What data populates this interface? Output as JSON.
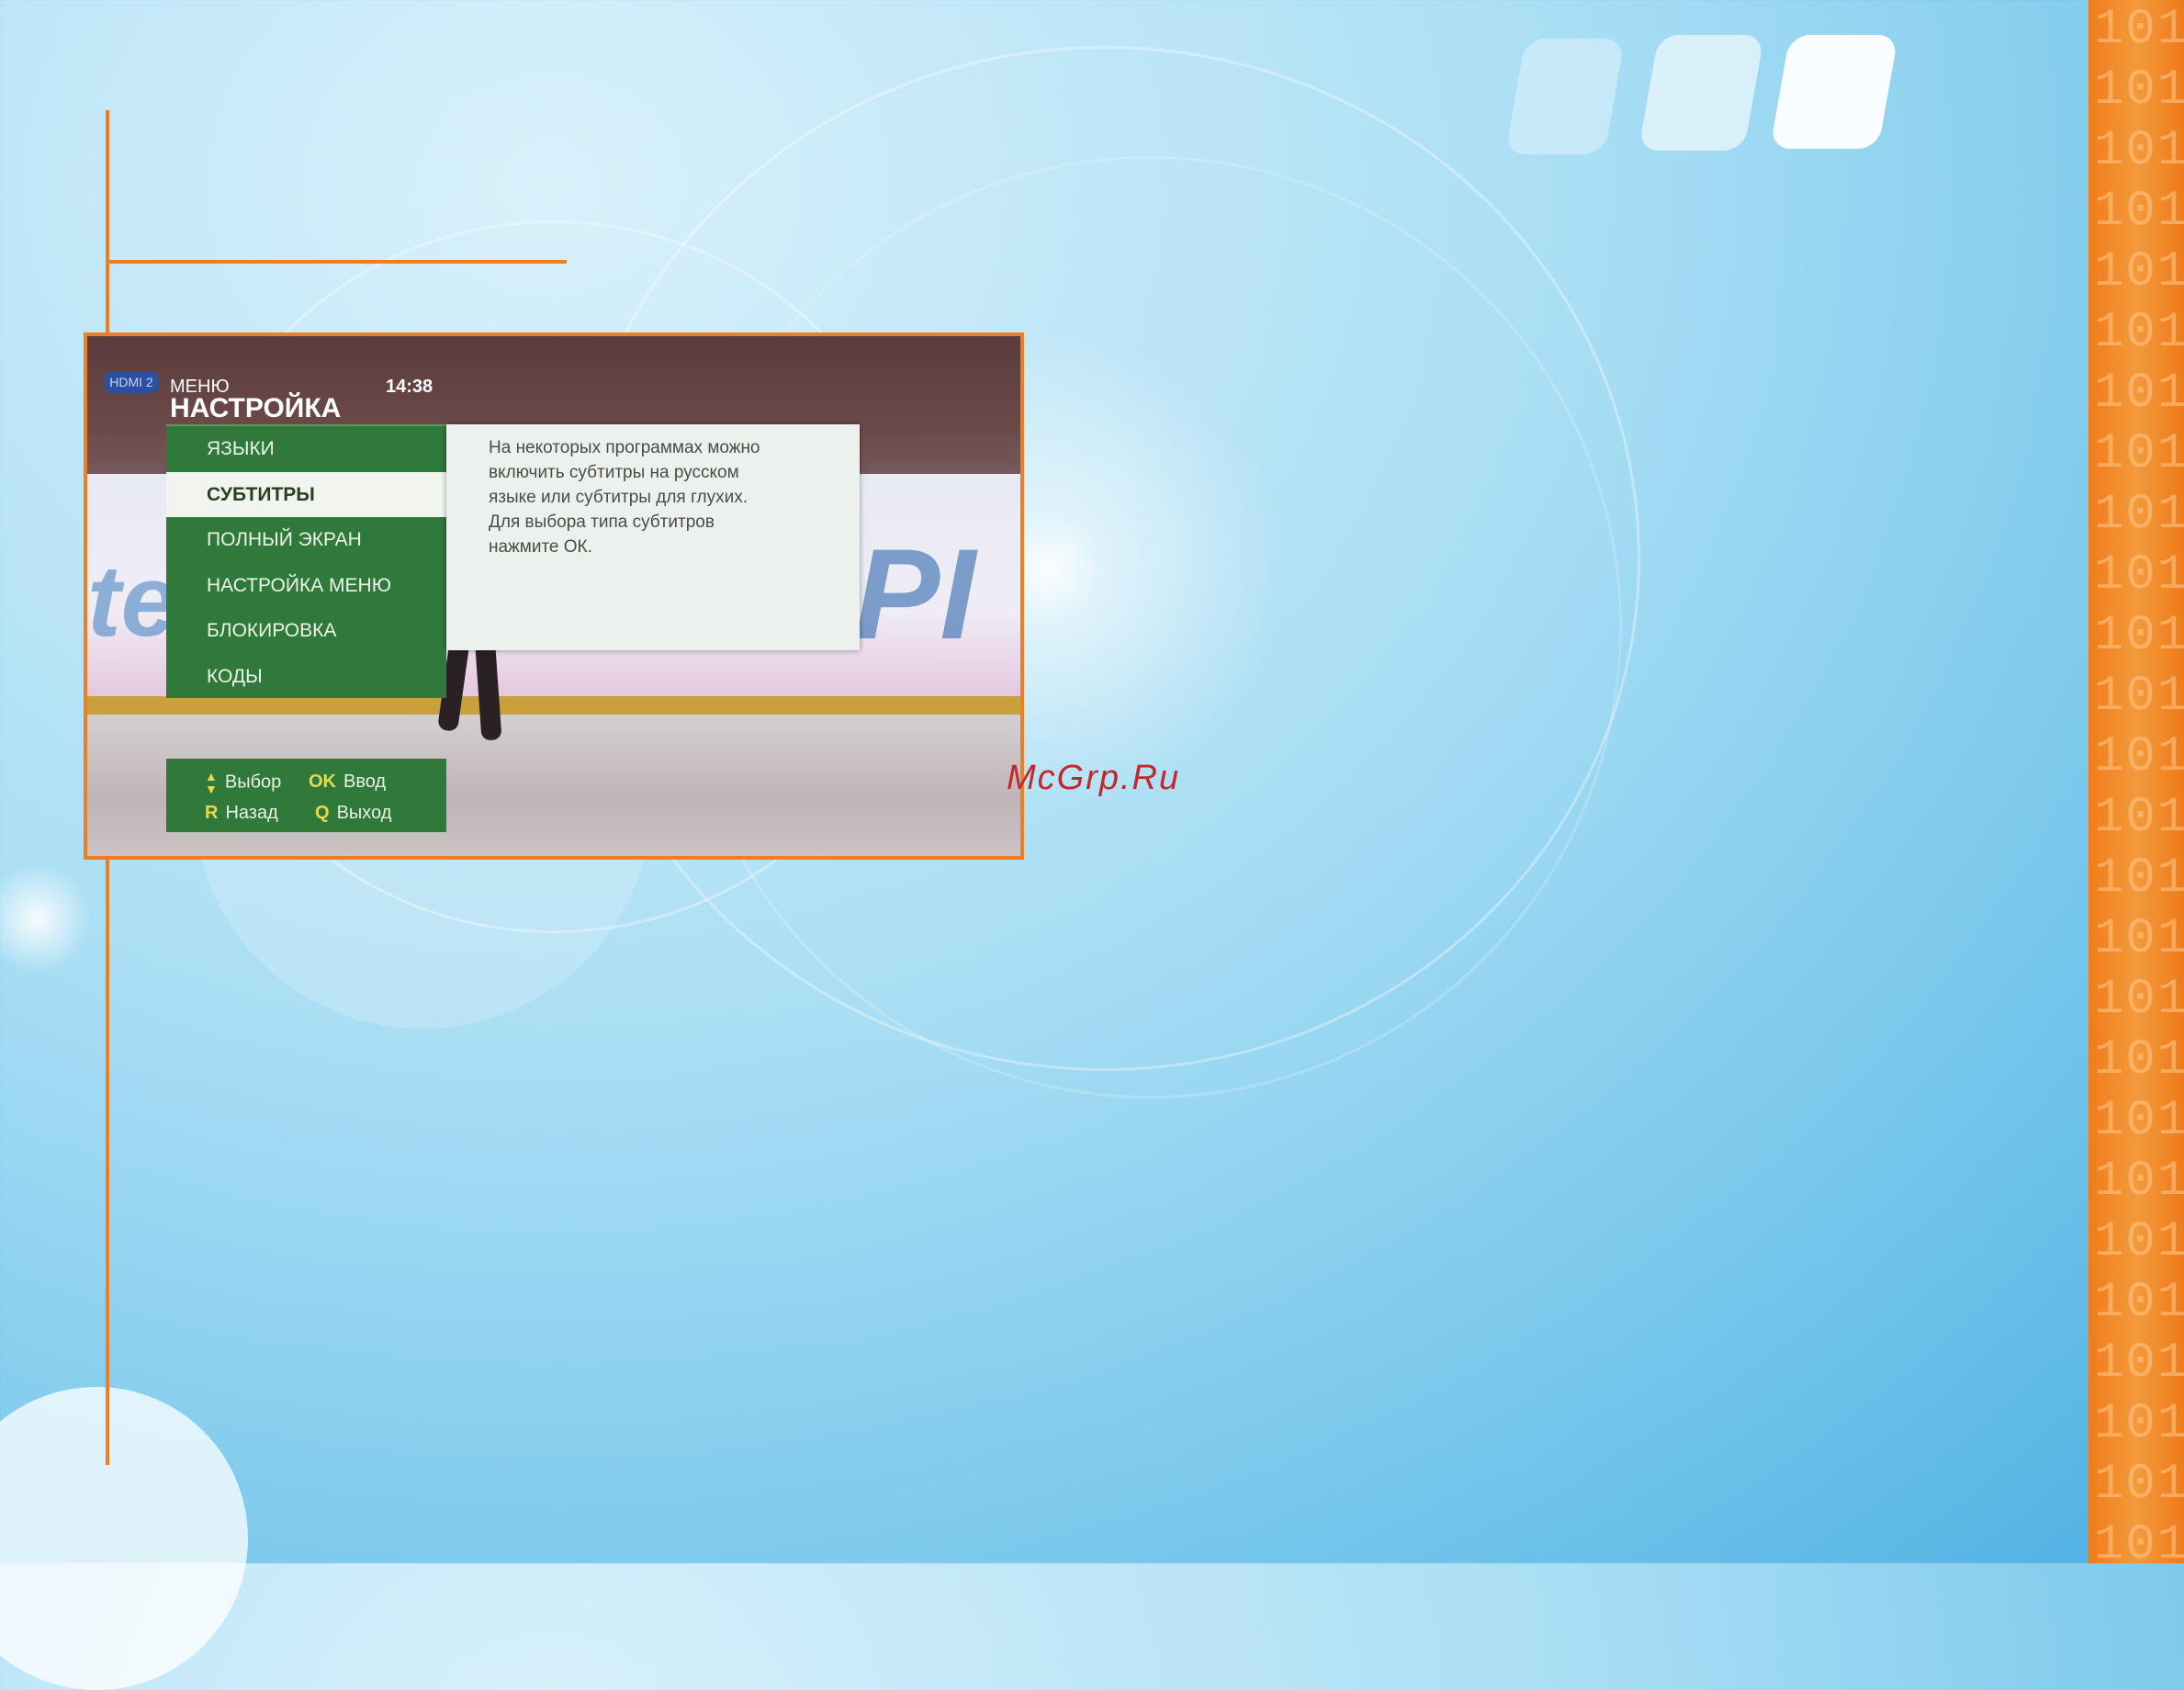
{
  "page": {
    "watermark": "McGrp.Ru",
    "strip_digits": [
      "101",
      "101",
      "101",
      "101",
      "101",
      "101",
      "101",
      "101",
      "101",
      "101",
      "101",
      "101",
      "101",
      "101",
      "101",
      "101",
      "101",
      "101",
      "101",
      "101",
      "101",
      "101",
      "101",
      "101",
      "101",
      "101"
    ],
    "colors": {
      "accent_orange": "#ef7d22",
      "menu_green": "#2f7a3a",
      "selected_bg": "#f2f5ef",
      "watermark_red": "#c2282d"
    }
  },
  "tv": {
    "input_badge": "HDMI 2",
    "menu_caption": "МЕНЮ",
    "menu_title": "НАСТРОЙКА",
    "time": "14:38",
    "menu_items": [
      {
        "label": "ЯЗЫКИ",
        "selected": false
      },
      {
        "label": "СУБТИТРЫ",
        "selected": true
      },
      {
        "label": "ПОЛНЫЙ ЭКРАН",
        "selected": false
      },
      {
        "label": "НАСТРОЙКА МЕНЮ",
        "selected": false
      },
      {
        "label": "БЛОКИРОВКА",
        "selected": false
      },
      {
        "label": "КОДЫ",
        "selected": false
      }
    ],
    "description": [
      "На некоторых программах можно",
      "включить субтитры на русском",
      "языке или субтитры для глухих.",
      "Для выбора типа субтитров",
      "нажмите ОК."
    ],
    "help": {
      "select_icon": "up-down-arrows-icon",
      "select_label": "Выбор",
      "ok_key": "OK",
      "ok_label": "Ввод",
      "back_key": "R",
      "back_label": "Назад",
      "exit_key": "Q",
      "exit_label": "Выход"
    }
  }
}
